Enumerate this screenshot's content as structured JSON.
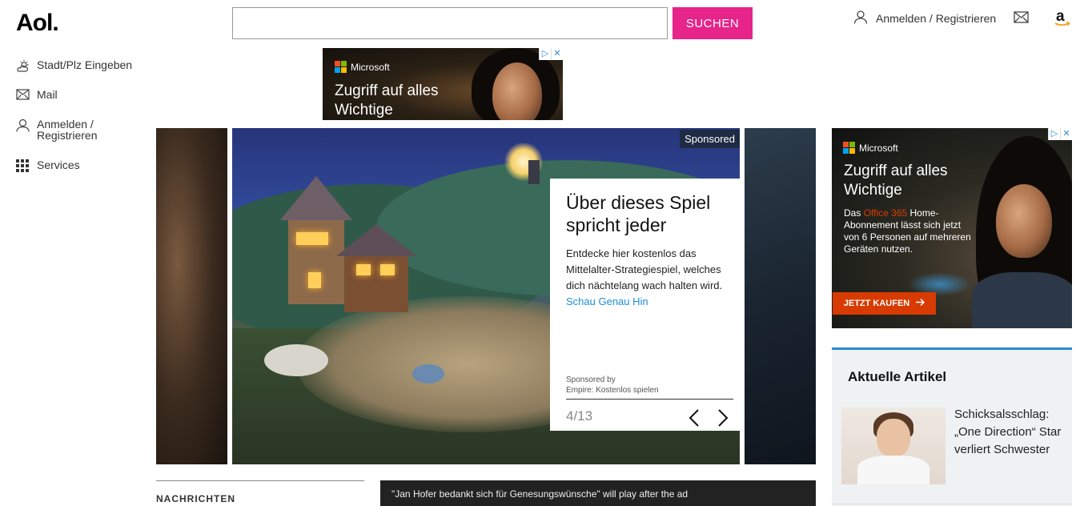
{
  "header": {
    "logo": "Aol.",
    "search_placeholder": "",
    "search_button": "SUCHEN",
    "login_label": "Anmelden / Registrieren",
    "amazon_icon": "amazon-a-icon"
  },
  "sidebar": {
    "items": [
      {
        "label": "Stadt/Plz Eingeben",
        "icon": "weather-icon"
      },
      {
        "label": "Mail",
        "icon": "mail-icon"
      },
      {
        "label": "Anmelden / Registrieren",
        "label_line1": "Anmelden /",
        "label_line2": "Registrieren",
        "icon": "user-icon"
      },
      {
        "label": "Services",
        "icon": "grid-icon"
      }
    ]
  },
  "top_ad": {
    "brand": "Microsoft",
    "headline_line1": "Zugriff auf alles",
    "headline_line2": "Wichtige"
  },
  "carousel": {
    "sponsored_tag": "Sponsored",
    "card": {
      "title": "Über dieses Spiel spricht jeder",
      "description": "Entdecke hier kostenlos das Mittelalter-Strategiespiel, welches dich nächtelang wach halten wird.",
      "link": "Schau Genau Hin",
      "sponsored_by_label": "Sponsored by",
      "sponsor": "Empire: Kostenlos spielen",
      "counter": "4/13"
    }
  },
  "side_ad": {
    "brand": "Microsoft",
    "headline_line1": "Zugriff auf alles",
    "headline_line2": "Wichtige",
    "body_prefix": "Das ",
    "body_highlight": "Office 365",
    "body_rest": " Home-Abonnement lässt sich jetzt von 6 Personen auf mehreren Geräten nutzen.",
    "cta": "JETZT KAUFEN",
    "highlight_color": "#d83b01"
  },
  "news": {
    "section_label": "NACHRICHTEN",
    "video_caption": "\"Jan Hofer bedankt sich für Genesungswünsche\" will play after the ad"
  },
  "aktuelle_artikel": {
    "title": "Aktuelle Artikel",
    "articles": [
      {
        "text": "Schicksalsschlag: „One Direction“ Star verliert Schwester"
      }
    ]
  },
  "colors": {
    "accent_pink": "#e6248a",
    "link_blue": "#1d8ed8",
    "section_blue": "#2a8bd8"
  }
}
